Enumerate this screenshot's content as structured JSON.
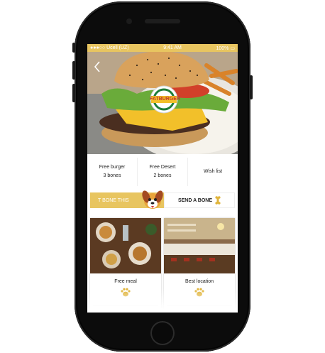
{
  "status_bar": {
    "carrier": "Ucell (UZ)",
    "time": "9:41 AM",
    "battery": "100%"
  },
  "header": {
    "back_icon": "chevron-left-icon",
    "brand_logo_text": "FATBURGER"
  },
  "rewards": [
    {
      "title": "Free burger",
      "value": "3 bones"
    },
    {
      "title": "Free Desert",
      "value": "2 bones"
    },
    {
      "title": "Wish list",
      "value": ""
    }
  ],
  "actions": {
    "tbone_label": "T BONE THIS",
    "send_bone_label": "SEND A BONE"
  },
  "cards": [
    {
      "label": "Free meal",
      "icon": "paw-icon"
    },
    {
      "label": "Best location",
      "icon": "paw-icon"
    }
  ],
  "colors": {
    "accent": "#e8c560",
    "paw": "#e0b43a",
    "phone_frame": "#0c0c0c"
  }
}
